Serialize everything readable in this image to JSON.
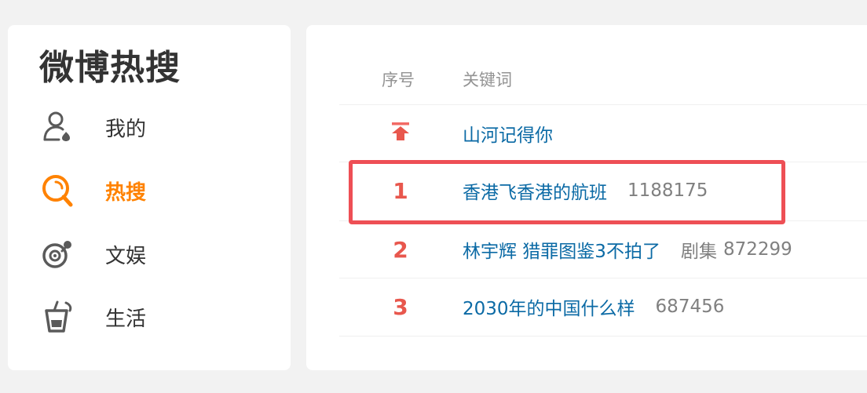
{
  "sidebar": {
    "title": "微博热搜",
    "items": [
      {
        "label": "我的",
        "icon": "user-icon",
        "active": false
      },
      {
        "label": "热搜",
        "icon": "search-icon",
        "active": true
      },
      {
        "label": "文娱",
        "icon": "entertainment-icon",
        "active": false
      },
      {
        "label": "生活",
        "icon": "lifestyle-icon",
        "active": false
      }
    ]
  },
  "table": {
    "headers": {
      "rank": "序号",
      "keyword": "关键词"
    },
    "pinned": {
      "icon": "pin-top-icon",
      "keyword": "山河记得你"
    },
    "rows": [
      {
        "rank": "1",
        "keyword": "香港飞香港的航班",
        "category": "",
        "count": "1188175"
      },
      {
        "rank": "2",
        "keyword": "林宇辉 猎罪图鉴3不拍了",
        "category": "剧集",
        "count": "872299"
      },
      {
        "rank": "3",
        "keyword": "2030年的中国什么样",
        "category": "",
        "count": "687456"
      }
    ]
  },
  "colors": {
    "accent": "#ff8200",
    "rank_red": "#e8574d",
    "link_blue": "#0b6aa5",
    "highlight": "#ee4f55"
  }
}
